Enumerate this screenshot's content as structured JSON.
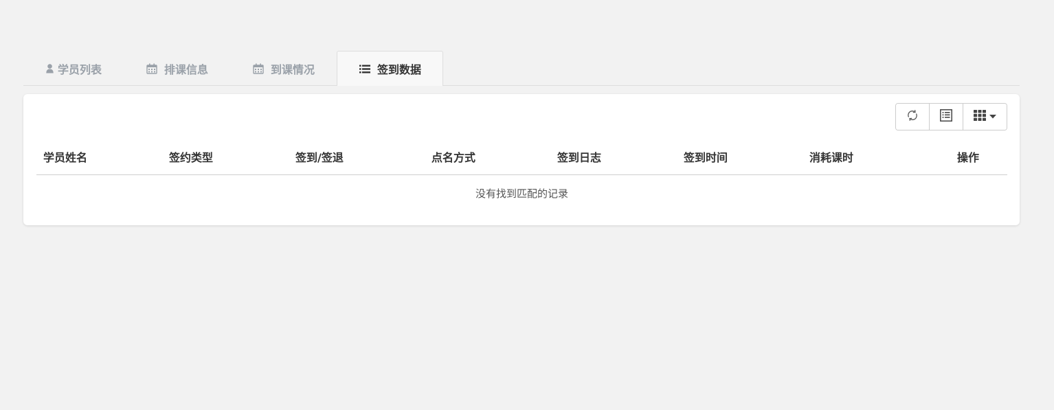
{
  "tabs": [
    {
      "label": "学员列表",
      "icon": "user-icon",
      "active": false
    },
    {
      "label": "排课信息",
      "icon": "calendar-icon",
      "active": false
    },
    {
      "label": "到课情况",
      "icon": "calendar-icon",
      "active": false
    },
    {
      "label": "签到数据",
      "icon": "list-icon",
      "active": true
    }
  ],
  "toolbar": {
    "buttons": [
      {
        "icon": "refresh-icon"
      },
      {
        "icon": "toggle-view-icon"
      },
      {
        "icon": "columns-icon",
        "has_dropdown": true
      }
    ]
  },
  "table": {
    "columns": [
      "学员姓名",
      "签约类型",
      "签到/签退",
      "点名方式",
      "签到日志",
      "签到时间",
      "消耗课时",
      "操作"
    ],
    "empty_text": "没有找到匹配的记录"
  },
  "colors": {
    "background": "#f2f2f2",
    "panel": "#ffffff",
    "tab_inactive": "#9aa1a9",
    "tab_active_text": "#333333",
    "border": "#dddddd"
  }
}
